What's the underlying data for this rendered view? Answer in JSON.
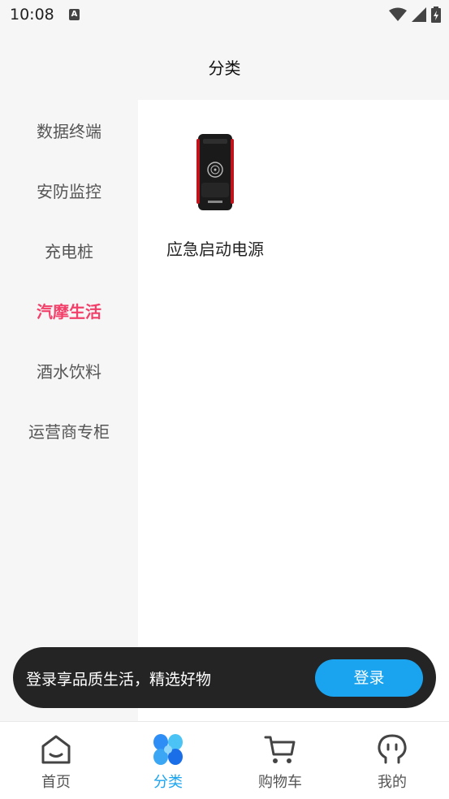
{
  "status": {
    "time": "10:08",
    "app_indicator": "A"
  },
  "header": {
    "title": "分类"
  },
  "sidebar": {
    "items": [
      {
        "label": "数据终端",
        "active": false
      },
      {
        "label": "安防监控",
        "active": false
      },
      {
        "label": "充电桩",
        "active": false
      },
      {
        "label": "汽摩生活",
        "active": true
      },
      {
        "label": "酒水饮料",
        "active": false
      },
      {
        "label": "运营商专柜",
        "active": false
      }
    ]
  },
  "content": {
    "products": [
      {
        "name": "应急启动电源",
        "image_icon": "power-bank-image"
      }
    ]
  },
  "login_banner": {
    "text": "登录享品质生活，精选好物",
    "button_label": "登录"
  },
  "tabbar": {
    "tabs": [
      {
        "label": "首页",
        "icon": "home-icon",
        "active": false
      },
      {
        "label": "分类",
        "icon": "category-icon",
        "active": true
      },
      {
        "label": "购物车",
        "icon": "cart-icon",
        "active": false
      },
      {
        "label": "我的",
        "icon": "profile-icon",
        "active": false
      }
    ]
  },
  "colors": {
    "accent": "#1aa4f0",
    "active_category": "#f2406a",
    "banner_bg": "#242424"
  }
}
